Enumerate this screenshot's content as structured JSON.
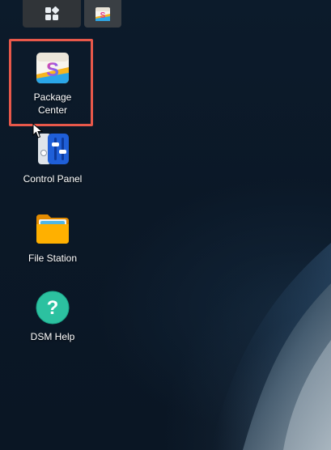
{
  "taskbar": {
    "main_menu_icon": "grid-icon",
    "open_app_icon": "package-center-icon"
  },
  "desktop": {
    "icons": [
      {
        "label": "Package\nCenter",
        "icon": "package-center-icon"
      },
      {
        "label": "Control Panel",
        "icon": "control-panel-icon"
      },
      {
        "label": "File Station",
        "icon": "folder-icon"
      },
      {
        "label": "DSM Help",
        "icon": "help-icon"
      }
    ]
  },
  "colors": {
    "highlight": "#e8584a",
    "help_green": "#2cc1a0",
    "control_blue": "#1f5fd8",
    "folder_orange": "#f4a000"
  }
}
